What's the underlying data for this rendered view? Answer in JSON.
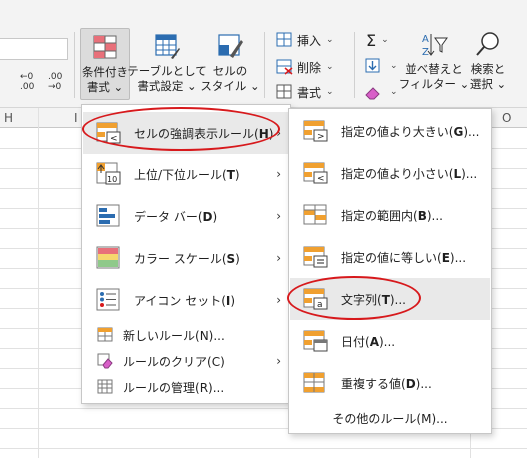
{
  "ribbon": {
    "format_small_1": "←0\n.00",
    "format_small_2": ".00\n→0",
    "conditional_formatting": {
      "line1": "条件付き",
      "line2": "書式 ⌄"
    },
    "format_as_table": {
      "line1": "テーブルとして",
      "line2": "書式設定 ⌄"
    },
    "cell_styles": {
      "line1": "セルの",
      "line2": "スタイル ⌄"
    },
    "insert": "挿入",
    "delete": "削除",
    "format": "書式",
    "sigma": "Σ",
    "sort_filter": {
      "line1": "並べ替えと",
      "line2": "フィルター ⌄"
    },
    "find_select": {
      "line1": "検索と",
      "line2": "選択 ⌄"
    }
  },
  "columns": [
    "H",
    "I",
    "O"
  ],
  "menu_left": {
    "items": [
      {
        "label": "セルの強調表示ルール(",
        "key": "H",
        "tail": ")",
        "has_sub": true
      },
      {
        "label": "上位/下位ルール(",
        "key": "T",
        "tail": ")",
        "has_sub": true
      },
      {
        "label": "データ バー(",
        "key": "D",
        "tail": ")",
        "has_sub": true
      },
      {
        "label": "カラー スケール(",
        "key": "S",
        "tail": ")",
        "has_sub": true
      },
      {
        "label": "アイコン セット(",
        "key": "I",
        "tail": ")",
        "has_sub": true
      }
    ],
    "small_items": [
      {
        "label": "新しいルール(",
        "key": "N",
        "tail": ")..."
      },
      {
        "label": "ルールのクリア(",
        "key": "C",
        "tail": ")"
      },
      {
        "label": "ルールの管理(",
        "key": "R",
        "tail": ")..."
      }
    ]
  },
  "menu_right": {
    "items": [
      {
        "label": "指定の値より大きい(",
        "key": "G",
        "tail": ")..."
      },
      {
        "label": "指定の値より小さい(",
        "key": "L",
        "tail": ")..."
      },
      {
        "label": "指定の範囲内(",
        "key": "B",
        "tail": ")..."
      },
      {
        "label": "指定の値に等しい(",
        "key": "E",
        "tail": ")..."
      },
      {
        "label": "文字列(",
        "key": "T",
        "tail": ")..."
      },
      {
        "label": "日付(",
        "key": "A",
        "tail": ")..."
      },
      {
        "label": "重複する値(",
        "key": "D",
        "tail": ")..."
      }
    ],
    "more_rules": {
      "label": "その他のルール(",
      "key": "M",
      "tail": ")..."
    }
  },
  "colors": {
    "accent_red": "#d7191c",
    "icon_blue": "#2b6cb0",
    "icon_orange": "#f0a030",
    "icon_pink": "#e8707a",
    "menu_highlight": "#e9e9e9"
  }
}
